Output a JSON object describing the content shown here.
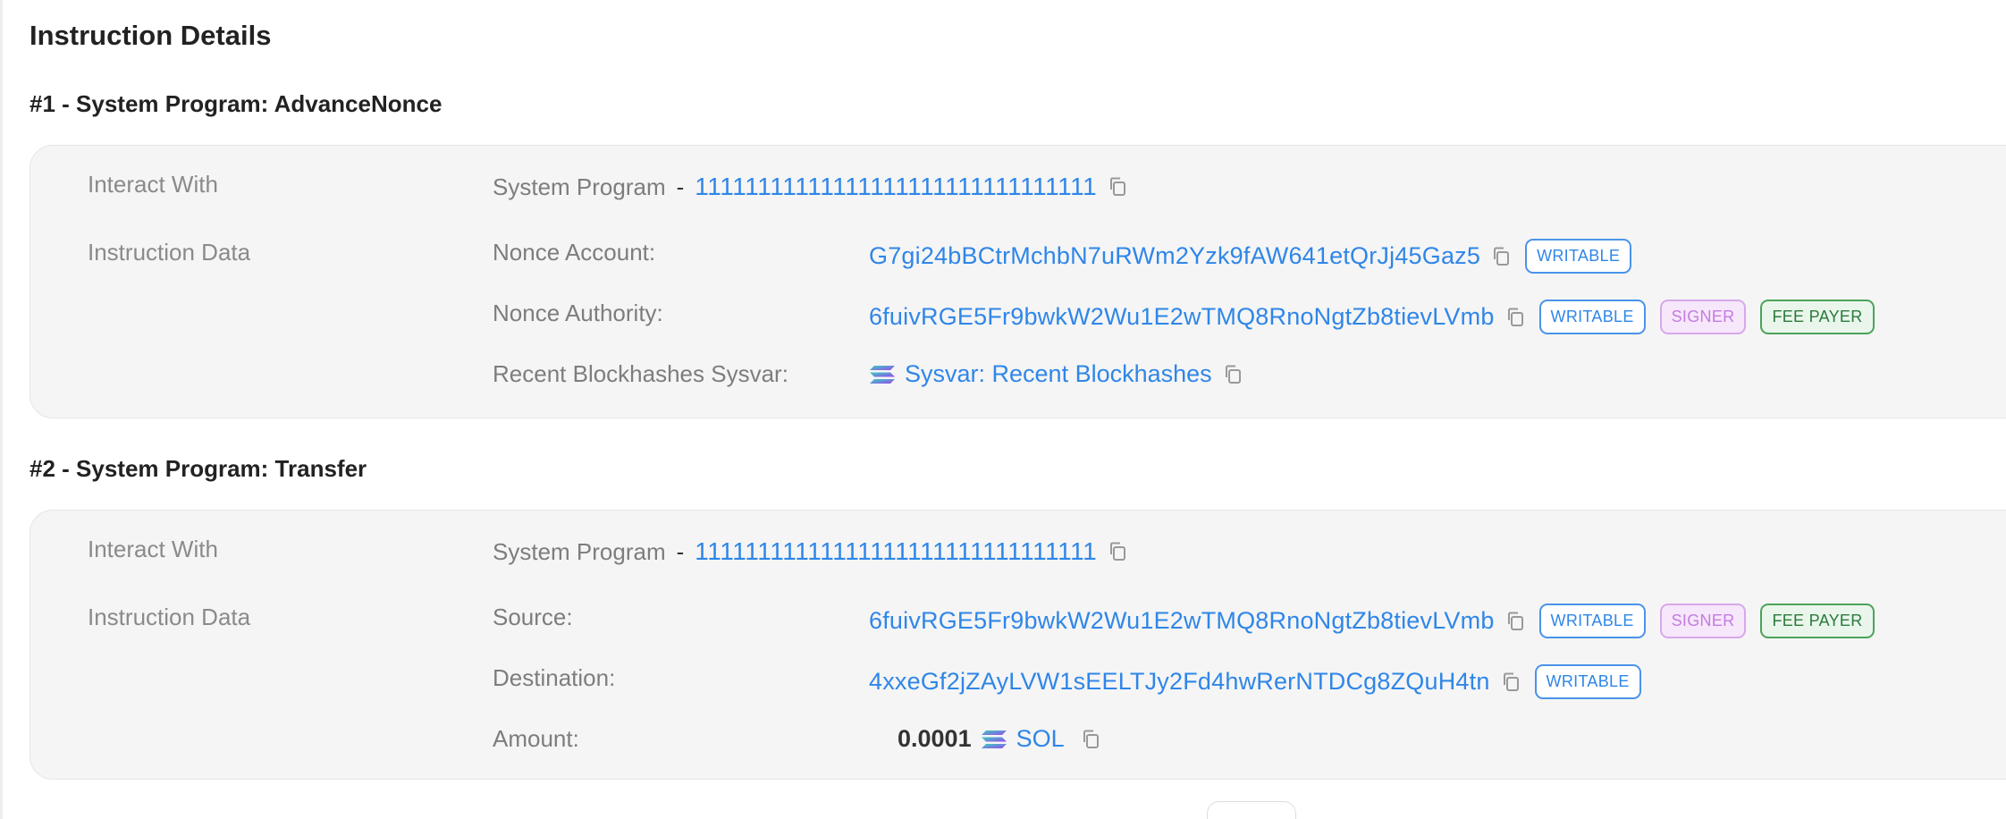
{
  "section_title": "Instruction Details",
  "instructions": [
    {
      "title": "#1 - System Program: AdvanceNonce",
      "interact_label": "Interact With",
      "program_name": "System Program",
      "dash": "-",
      "program_address": "11111111111111111111111111111111",
      "data_label": "Instruction Data",
      "rows": [
        {
          "key": "Nonce Account:",
          "value": "G7gi24bBCtrMchbN7uRWm2Yzk9fAW641etQrJj45Gaz5",
          "badges": [
            "WRITABLE"
          ]
        },
        {
          "key": "Nonce Authority:",
          "value": "6fuivRGE5Fr9bwkW2Wu1E2wTMQ8RnoNgtZb8tievLVmb",
          "badges": [
            "WRITABLE",
            "SIGNER",
            "FEE PAYER"
          ]
        },
        {
          "key": "Recent Blockhashes Sysvar:",
          "value": "Sysvar: Recent Blockhashes",
          "icon": "solana-logo-icon"
        }
      ]
    },
    {
      "title": "#2 - System Program: Transfer",
      "interact_label": "Interact With",
      "program_name": "System Program",
      "dash": "-",
      "program_address": "11111111111111111111111111111111",
      "data_label": "Instruction Data",
      "rows": [
        {
          "key": "Source:",
          "value": "6fuivRGE5Fr9bwkW2Wu1E2wTMQ8RnoNgtZb8tievLVmb",
          "badges": [
            "WRITABLE",
            "SIGNER",
            "FEE PAYER"
          ]
        },
        {
          "key": "Destination:",
          "value": "4xxeGf2jZAyLVW1sEELTJy2Fd4hwRerNTDCg8ZQuH4tn",
          "badges": [
            "WRITABLE"
          ]
        },
        {
          "key": "Amount:",
          "amount": "0.0001",
          "token": "SOL",
          "icon": "solana-logo-icon"
        }
      ]
    }
  ],
  "colors": {
    "link": "#2f86e8",
    "writable": "#2f86e8",
    "signer": "#c57be0",
    "fee_payer": "#2a7a3a",
    "card_bg": "#f5f5f5"
  },
  "icons": [
    "copy-icon",
    "solana-logo-icon"
  ]
}
